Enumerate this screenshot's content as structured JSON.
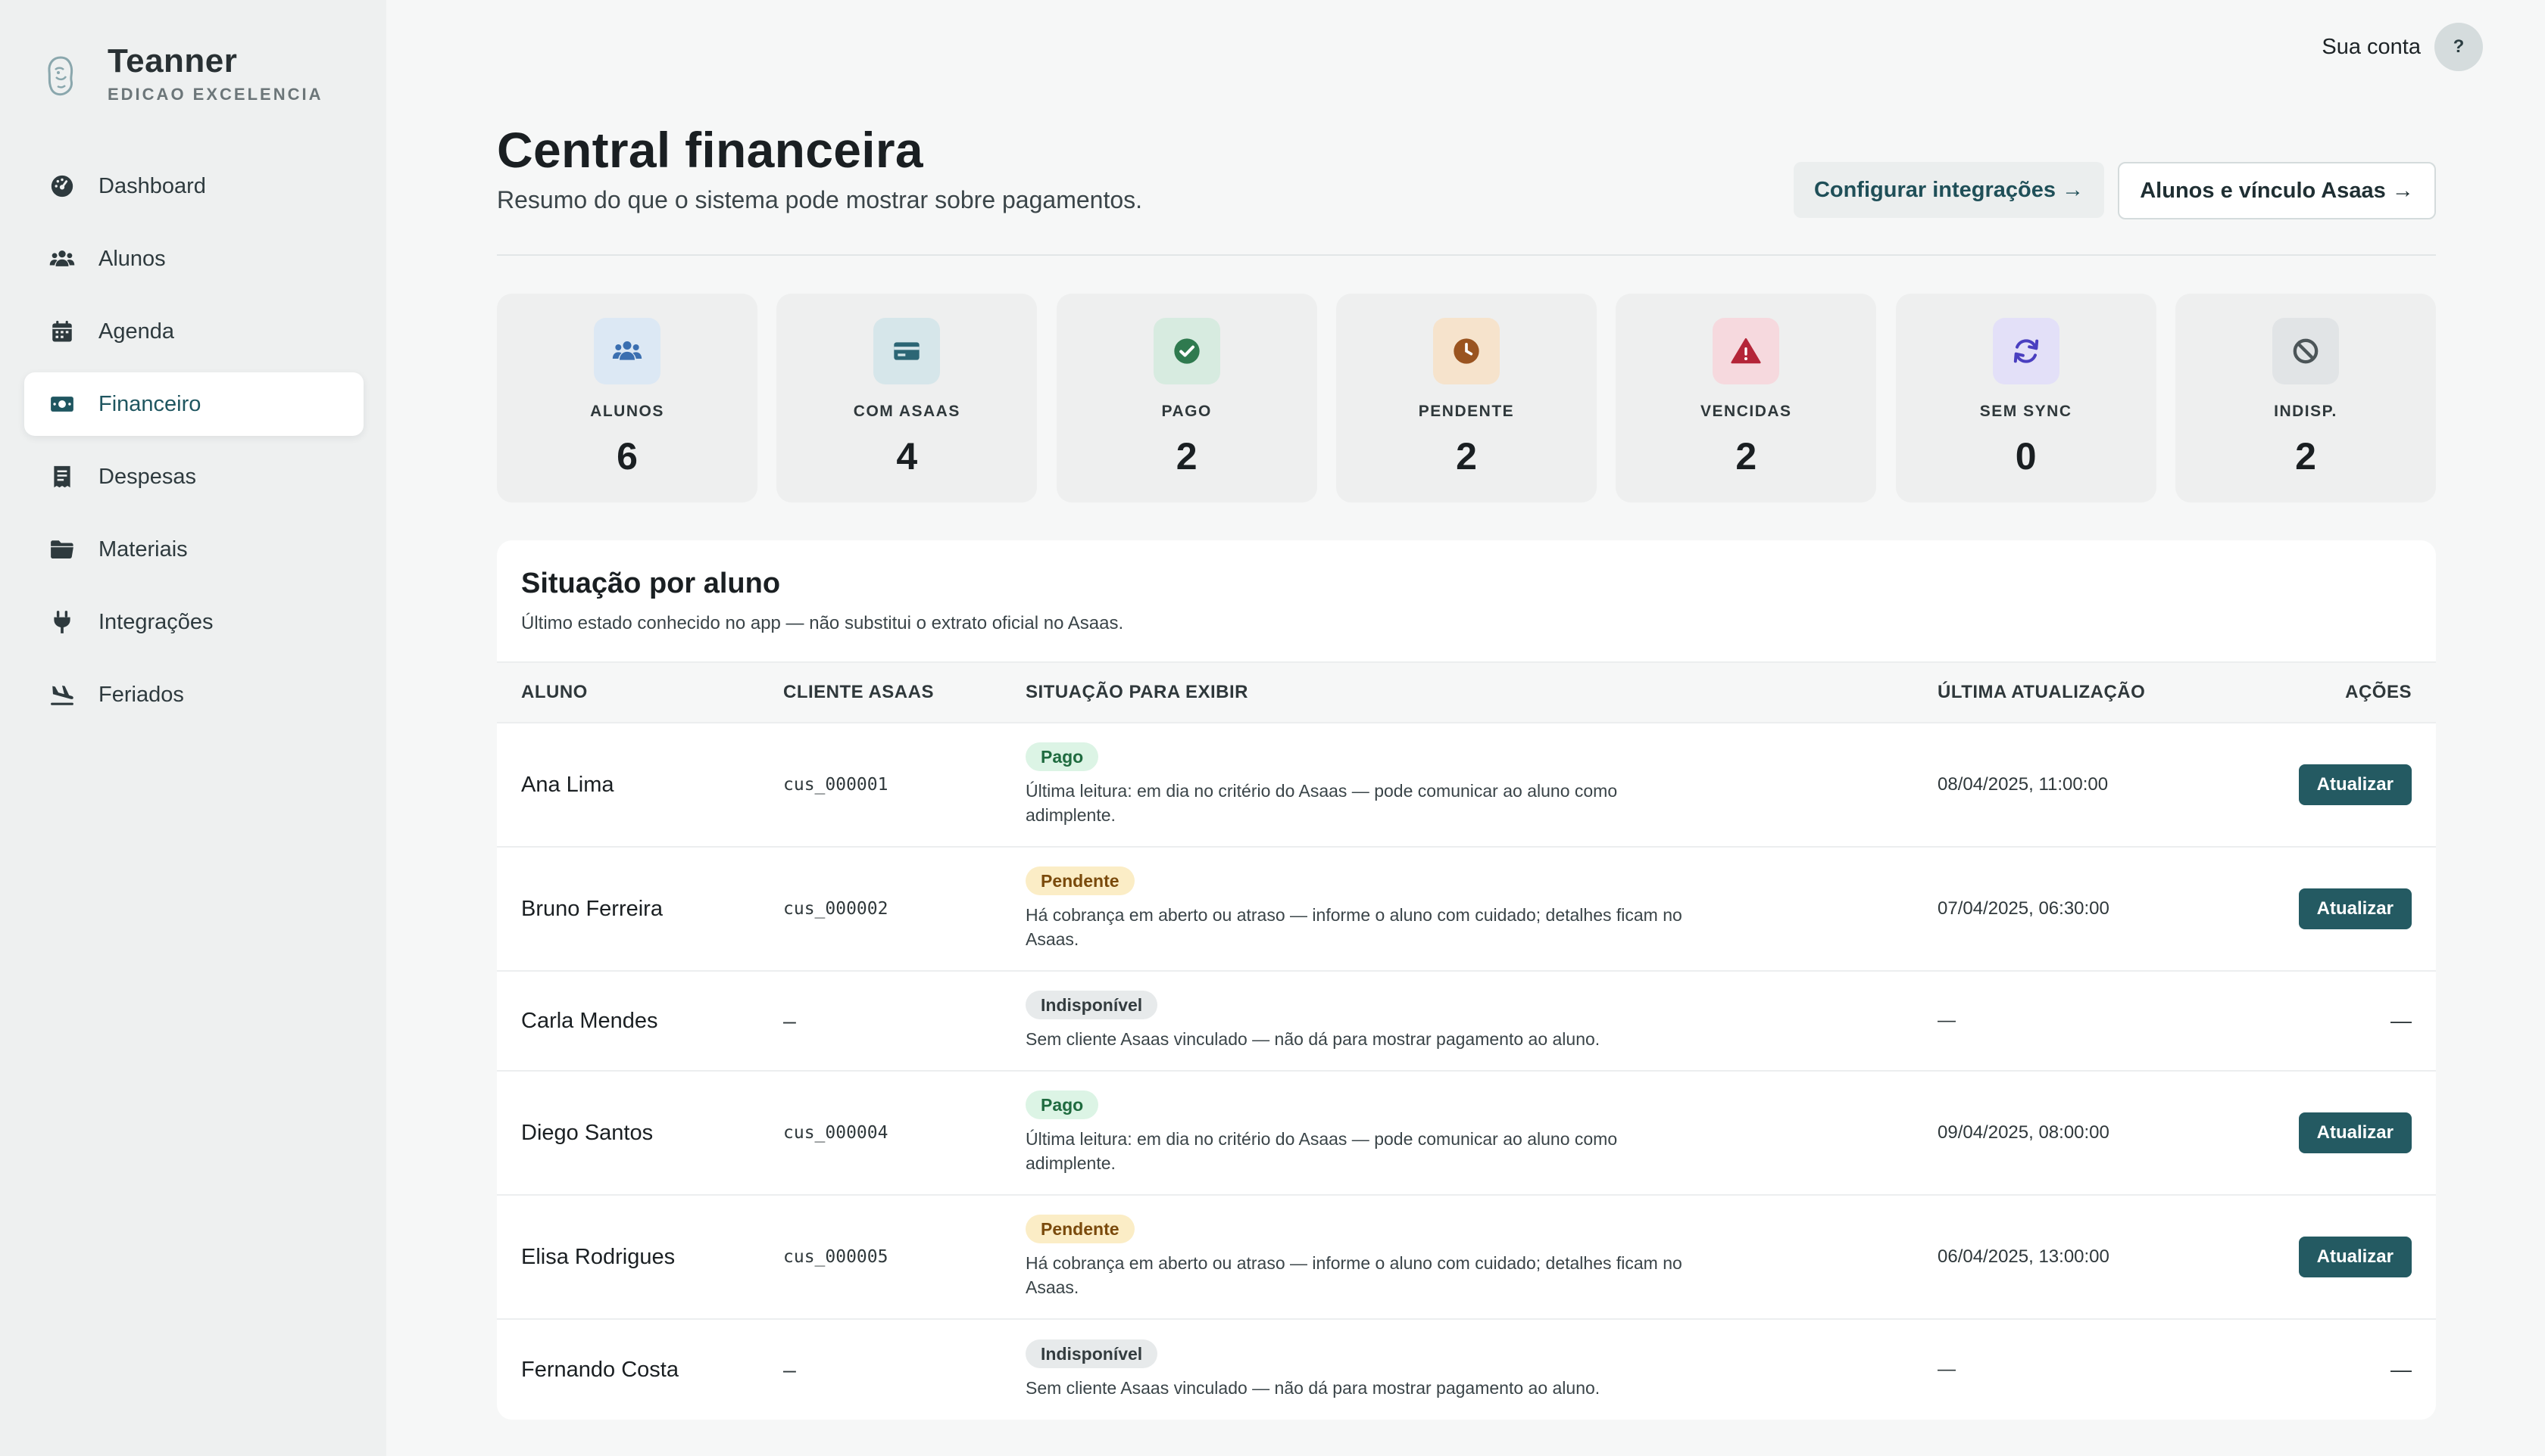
{
  "brand": {
    "name": "Teanner",
    "subtitle": "EDICAO EXCELENCIA"
  },
  "sidebar": {
    "items": [
      {
        "label": "Dashboard",
        "icon": "gauge-icon",
        "active": false
      },
      {
        "label": "Alunos",
        "icon": "users-icon",
        "active": false
      },
      {
        "label": "Agenda",
        "icon": "calendar-icon",
        "active": false
      },
      {
        "label": "Financeiro",
        "icon": "money-icon",
        "active": true
      },
      {
        "label": "Despesas",
        "icon": "receipt-icon",
        "active": false
      },
      {
        "label": "Materiais",
        "icon": "folder-icon",
        "active": false
      },
      {
        "label": "Integrações",
        "icon": "plug-icon",
        "active": false
      },
      {
        "label": "Feriados",
        "icon": "plane-landing-icon",
        "active": false
      }
    ]
  },
  "header": {
    "account_label": "Sua conta",
    "avatar_text": "?"
  },
  "page": {
    "title": "Central financeira",
    "subtitle": "Resumo do que o sistema pode mostrar sobre pagamentos.",
    "config_button": "Configurar integrações →",
    "students_button": "Alunos e vínculo Asaas →"
  },
  "stats": [
    {
      "label": "ALUNOS",
      "value": "6",
      "icon": "users-icon",
      "bg": "#dce8f4",
      "fg": "#3b6fb0"
    },
    {
      "label": "COM ASAAS",
      "value": "4",
      "icon": "card-icon",
      "bg": "#d6e6ea",
      "fg": "#2c6675"
    },
    {
      "label": "PAGO",
      "value": "2",
      "icon": "check-circle-icon",
      "bg": "#d7ebe0",
      "fg": "#2f7a4f"
    },
    {
      "label": "PENDENTE",
      "value": "2",
      "icon": "clock-icon",
      "bg": "#f6e3cc",
      "fg": "#9a5420"
    },
    {
      "label": "VENCIDAS",
      "value": "2",
      "icon": "warning-icon",
      "bg": "#f6d9de",
      "fg": "#b42538"
    },
    {
      "label": "SEM SYNC",
      "value": "0",
      "icon": "sync-icon",
      "bg": "#e3e0f8",
      "fg": "#4a3fc0"
    },
    {
      "label": "INDISP.",
      "value": "2",
      "icon": "ban-icon",
      "bg": "#e1e4e6",
      "fg": "#4c5558"
    }
  ],
  "table": {
    "title": "Situação por aluno",
    "note": "Último estado conhecido no app — não substitui o extrato oficial no Asaas.",
    "columns": {
      "student": "ALUNO",
      "client": "CLIENTE ASAAS",
      "status": "SITUAÇÃO PARA EXIBIR",
      "updated": "ÚLTIMA ATUALIZAÇÃO",
      "actions": "AÇÕES"
    },
    "action_label": "Atualizar",
    "rows": [
      {
        "name": "Ana Lima",
        "client": "cus_000001",
        "badge": "Pago",
        "badge_type": "pago",
        "desc": "Última leitura: em dia no critério do Asaas — pode comunicar ao aluno como adimplente.",
        "updated": "08/04/2025, 11:00:00",
        "action": "Atualizar"
      },
      {
        "name": "Bruno Ferreira",
        "client": "cus_000002",
        "badge": "Pendente",
        "badge_type": "pendente",
        "desc": "Há cobrança em aberto ou atraso — informe o aluno com cuidado; detalhes ficam no Asaas.",
        "updated": "07/04/2025, 06:30:00",
        "action": "Atualizar"
      },
      {
        "name": "Carla Mendes",
        "client": "—",
        "badge": "Indisponível",
        "badge_type": "indisp",
        "desc": "Sem cliente Asaas vinculado — não dá para mostrar pagamento ao aluno.",
        "updated": "—",
        "action": "—"
      },
      {
        "name": "Diego Santos",
        "client": "cus_000004",
        "badge": "Pago",
        "badge_type": "pago",
        "desc": "Última leitura: em dia no critério do Asaas — pode comunicar ao aluno como adimplente.",
        "updated": "09/04/2025, 08:00:00",
        "action": "Atualizar"
      },
      {
        "name": "Elisa Rodrigues",
        "client": "cus_000005",
        "badge": "Pendente",
        "badge_type": "pendente",
        "desc": "Há cobrança em aberto ou atraso — informe o aluno com cuidado; detalhes ficam no Asaas.",
        "updated": "06/04/2025, 13:00:00",
        "action": "Atualizar"
      },
      {
        "name": "Fernando Costa",
        "client": "—",
        "badge": "Indisponível",
        "badge_type": "indisp",
        "desc": "Sem cliente Asaas vinculado — não dá para mostrar pagamento ao aluno.",
        "updated": "—",
        "action": "—"
      }
    ]
  }
}
